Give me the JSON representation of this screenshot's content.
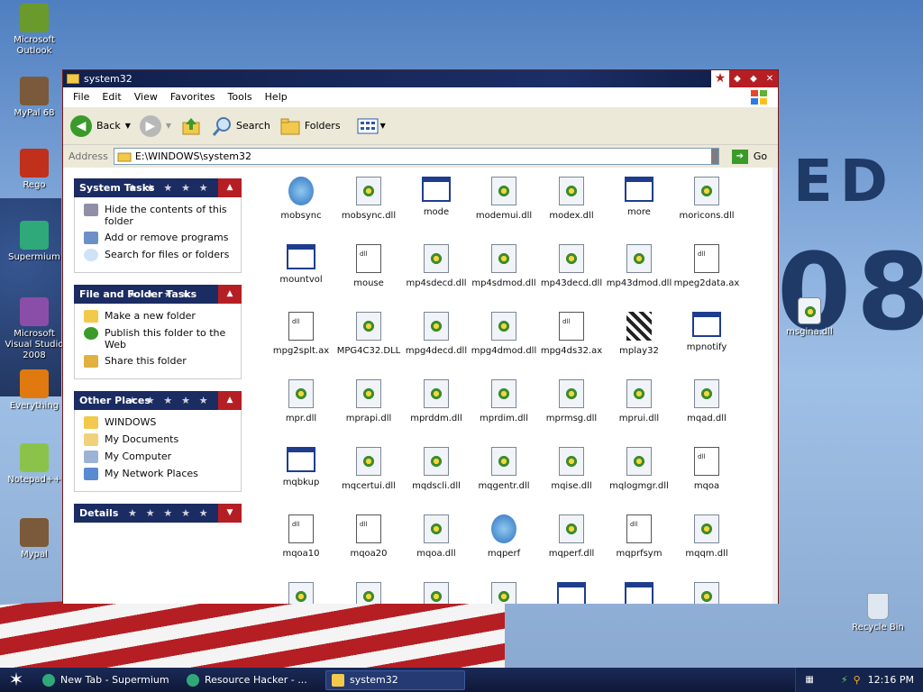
{
  "desktop": {
    "icons": [
      {
        "label": "Microsoft Outlook",
        "color": "#6a9a2c"
      },
      {
        "label": "MyPal 68",
        "color": "#7a5a3a"
      },
      {
        "label": "Rego",
        "color": "#c0301a"
      },
      {
        "label": "Supermium",
        "color": "#2fa87a"
      },
      {
        "label": "Microsoft Visual Studio 2008",
        "color": "#8a4ea8"
      },
      {
        "label": "Everything",
        "color": "#e07a10"
      },
      {
        "label": "Notepad++",
        "color": "#8bc34a"
      },
      {
        "label": "Mypal",
        "color": "#7a5a3a"
      }
    ],
    "right_icons": [
      {
        "label": "msgina.dll"
      },
      {
        "label": "Recycle Bin"
      }
    ],
    "wallpaper_text": [
      "ED",
      "08"
    ]
  },
  "window": {
    "title": "system32",
    "menu": [
      "File",
      "Edit",
      "View",
      "Favorites",
      "Tools",
      "Help"
    ],
    "toolbar": {
      "back": "Back",
      "search": "Search",
      "folders": "Folders"
    },
    "address": {
      "label": "Address",
      "value": "E:\\WINDOWS\\system32",
      "go": "Go"
    }
  },
  "tasks": {
    "system": {
      "title": "System Tasks",
      "items": [
        "Hide the contents of this folder",
        "Add or remove programs",
        "Search for files or folders"
      ]
    },
    "file_folder": {
      "title": "File and Folder Tasks",
      "items": [
        "Make a new folder",
        "Publish this folder to the Web",
        "Share this folder"
      ]
    },
    "other": {
      "title": "Other Places",
      "items": [
        "WINDOWS",
        "My Documents",
        "My Computer",
        "My Network Places"
      ]
    },
    "details": {
      "title": "Details"
    }
  },
  "files": [
    {
      "name": "mobsync",
      "type": "app"
    },
    {
      "name": "mobsync.dll",
      "type": "dll"
    },
    {
      "name": "mode",
      "type": "exe"
    },
    {
      "name": "modemui.dll",
      "type": "dll"
    },
    {
      "name": "modex.dll",
      "type": "dll"
    },
    {
      "name": "more",
      "type": "exe"
    },
    {
      "name": "moricons.dll",
      "type": "dll"
    },
    {
      "name": "mountvol",
      "type": "exe"
    },
    {
      "name": "mouse",
      "type": "txt"
    },
    {
      "name": "mp4sdecd.dll",
      "type": "dll"
    },
    {
      "name": "mp4sdmod.dll",
      "type": "dll"
    },
    {
      "name": "mp43decd.dll",
      "type": "dll"
    },
    {
      "name": "mp43dmod.dll",
      "type": "dll"
    },
    {
      "name": "mpeg2data.ax",
      "type": "txt"
    },
    {
      "name": "mpg2splt.ax",
      "type": "txt"
    },
    {
      "name": "MPG4C32.DLL",
      "type": "dll"
    },
    {
      "name": "mpg4decd.dll",
      "type": "dll"
    },
    {
      "name": "mpg4dmod.dll",
      "type": "dll"
    },
    {
      "name": "mpg4ds32.ax",
      "type": "txt"
    },
    {
      "name": "mplay32",
      "type": "media"
    },
    {
      "name": "mpnotify",
      "type": "exe"
    },
    {
      "name": "mpr.dll",
      "type": "dll"
    },
    {
      "name": "mprapi.dll",
      "type": "dll"
    },
    {
      "name": "mprddm.dll",
      "type": "dll"
    },
    {
      "name": "mprdim.dll",
      "type": "dll"
    },
    {
      "name": "mprmsg.dll",
      "type": "dll"
    },
    {
      "name": "mprui.dll",
      "type": "dll"
    },
    {
      "name": "mqad.dll",
      "type": "dll"
    },
    {
      "name": "mqbkup",
      "type": "exe"
    },
    {
      "name": "mqcertui.dll",
      "type": "dll"
    },
    {
      "name": "mqdscli.dll",
      "type": "dll"
    },
    {
      "name": "mqgentr.dll",
      "type": "dll"
    },
    {
      "name": "mqise.dll",
      "type": "dll"
    },
    {
      "name": "mqlogmgr.dll",
      "type": "dll"
    },
    {
      "name": "mqoa",
      "type": "txt"
    },
    {
      "name": "mqoa10",
      "type": "txt"
    },
    {
      "name": "mqoa20",
      "type": "txt"
    },
    {
      "name": "mqoa.dll",
      "type": "dll"
    },
    {
      "name": "mqperf",
      "type": "app"
    },
    {
      "name": "mqperf.dll",
      "type": "dll"
    },
    {
      "name": "mqprfsym",
      "type": "h"
    },
    {
      "name": "mqqm.dll",
      "type": "dll"
    },
    {
      "name": "",
      "type": "dll"
    },
    {
      "name": "",
      "type": "dll"
    },
    {
      "name": "",
      "type": "dll"
    },
    {
      "name": "",
      "type": "dll"
    },
    {
      "name": "",
      "type": "exe"
    },
    {
      "name": "",
      "type": "exe"
    },
    {
      "name": "",
      "type": "dll"
    }
  ],
  "taskbar": {
    "items": [
      "New Tab - Supermium",
      "Resource Hacker - ...",
      "system32"
    ],
    "active": 2,
    "clock": "12:16 PM"
  }
}
